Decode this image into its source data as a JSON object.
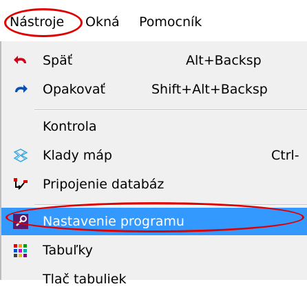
{
  "menubar": {
    "items": [
      {
        "label": "Nástroje"
      },
      {
        "label": "Okná"
      },
      {
        "label": "Pomocník"
      }
    ]
  },
  "menu": {
    "items": [
      {
        "label": "Späť",
        "shortcut": "Alt+Backsp",
        "icon": "undo-icon"
      },
      {
        "label": "Opakovať",
        "shortcut": "Shift+Alt+Backsp",
        "icon": "redo-icon"
      },
      {
        "label": "Kontrola",
        "shortcut": "",
        "icon": ""
      },
      {
        "label": "Klady máp",
        "shortcut": "Ctrl-",
        "icon": "map-sheets-icon"
      },
      {
        "label": "Pripojenie databáz",
        "shortcut": "",
        "icon": "database-connection-icon"
      },
      {
        "label": "Nastavenie programu",
        "shortcut": "",
        "icon": "program-settings-icon",
        "highlighted": true
      },
      {
        "label": "Tabuľky",
        "shortcut": "",
        "icon": "tables-icon"
      },
      {
        "label": "Tlač tabuliek",
        "shortcut": "",
        "icon": ""
      }
    ]
  },
  "colors": {
    "highlight": "#3399ff",
    "annotation": "#e00000"
  }
}
